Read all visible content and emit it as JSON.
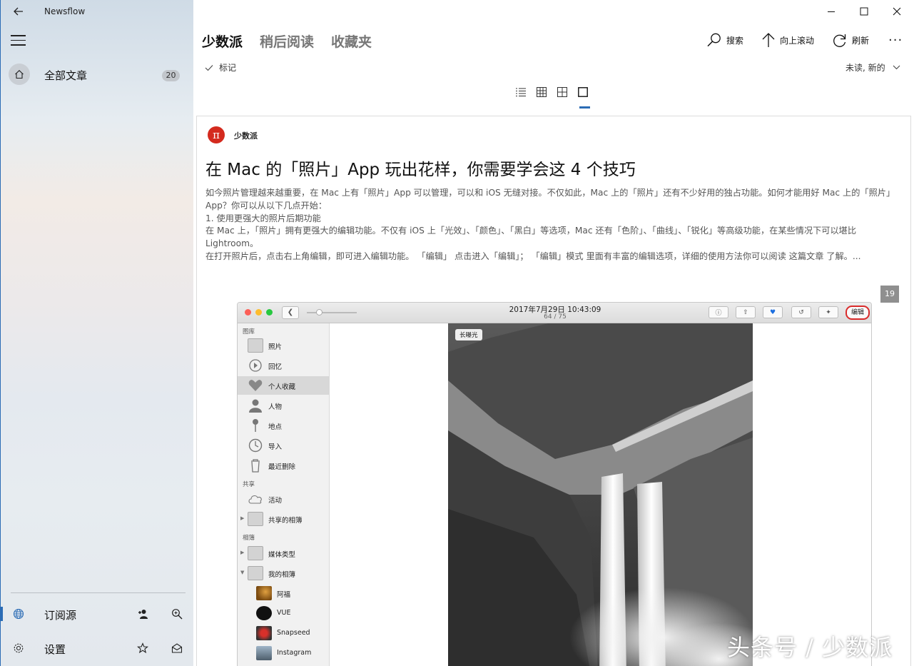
{
  "app": {
    "title": "Newsflow"
  },
  "sidebar": {
    "all_articles": {
      "label": "全部文章",
      "count": "20"
    },
    "subscriptions": {
      "label": "订阅源"
    },
    "settings": {
      "label": "设置"
    }
  },
  "header": {
    "tabs": [
      {
        "label": "少数派"
      },
      {
        "label": "稍后阅读"
      },
      {
        "label": "收藏夹"
      }
    ],
    "commands": {
      "search": "搜索",
      "scroll_up": "向上滚动",
      "refresh": "刷新"
    },
    "mark_label": "标记",
    "filter_label": "未读, 新的"
  },
  "article": {
    "source": "少数派",
    "source_logo_glyph": "π",
    "title": "在 Mac 的「照片」App 玩出花样，你需要学会这 4 个技巧",
    "paragraphs": [
      "如今照片管理越来越重要，在 Mac 上有「照片」App 可以管理，可以和 iOS 无缝对接。不仅如此，Mac 上的「照片」还有不少好用的独占功能。如何才能用好 Mac 上的「照片」App？你可以从以下几点开始：",
      "1. 使用更强大的照片后期功能",
      "在 Mac 上，「照片」拥有更强大的编辑功能。不仅有 iOS 上「光效」、「颜色」、「黑白」等选项，Mac 还有「色阶」、「曲线」、「锐化」等高级功能，在某些情况下可以堪比 Lightroom。",
      "在打开照片后，点击右上角编辑，即可进入编辑功能。 「编辑」 点击进入「编辑」； 「编辑」模式 里面有丰富的编辑选项，详细的使用方法你可以阅读 这篇文章 了解。..."
    ],
    "image_count": "19",
    "watermark": "头条号 / 少数派"
  },
  "mac_photos": {
    "date": "2017年7月29日 10:43:09",
    "counter": "64 / 75",
    "edit_button": "编辑",
    "photo_label": "长曝光",
    "sections": {
      "library": "图库",
      "shared": "共享",
      "albums": "相簿"
    },
    "library_items": [
      "照片",
      "回忆",
      "个人收藏",
      "人物",
      "地点",
      "导入",
      "最近删除"
    ],
    "shared_items": [
      "活动",
      "共享的相簿"
    ],
    "album_items": [
      "媒体类型",
      "我的相簿"
    ],
    "my_albums": [
      "阿福",
      "VUE",
      "Snapseed",
      "Instagram"
    ]
  },
  "colors": {
    "accent": "#2b6cb5",
    "logo_red": "#d42a1e",
    "edit_ring": "#d92b2b"
  }
}
